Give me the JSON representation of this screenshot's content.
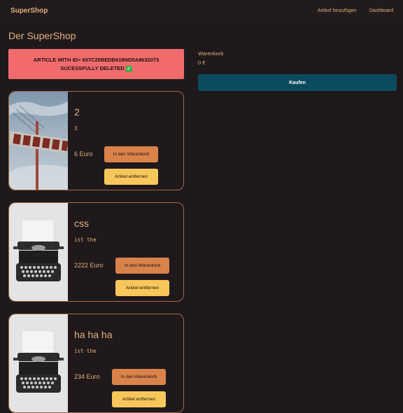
{
  "navbar": {
    "brand": "SuperShop",
    "links": [
      "Artikel hinzufügen",
      "Dashboard"
    ]
  },
  "page_title": "Der SuperShop",
  "alert": {
    "line1": "ARTICLE WITH ID= 657C25BEDB61B6D5A8632073",
    "line2": "SUCESSFULLY DELETED",
    "icon": "check-mark-icon",
    "color": "#f26b6c"
  },
  "cart": {
    "label": "Warenkorb",
    "total": "0 €",
    "buy_label": "Kaufen",
    "buy_color": "#0c4b5e"
  },
  "products": [
    {
      "title": "2",
      "description": "3",
      "price": "6 Euro",
      "image": "hotel-sign-photo",
      "add_label": "In den Warenkorb",
      "remove_label": "Artikel entfernen"
    },
    {
      "title": "css",
      "description": "ist the",
      "price": "2222 Euro",
      "image": "typewriter-photo",
      "add_label": "In den Warenkorb",
      "remove_label": "Artikel entfernen"
    },
    {
      "title": "ha ha ha",
      "description": "ist the",
      "price": "234 Euro",
      "image": "typewriter-photo",
      "add_label": "In den Warenkorb",
      "remove_label": "Artikel entfernen"
    }
  ],
  "colors": {
    "background": "#1f191c",
    "accent_text": "#e3b07a",
    "cart_button": "#d9834b",
    "remove_button": "#f8c75b",
    "card_border": "#a06a42"
  }
}
